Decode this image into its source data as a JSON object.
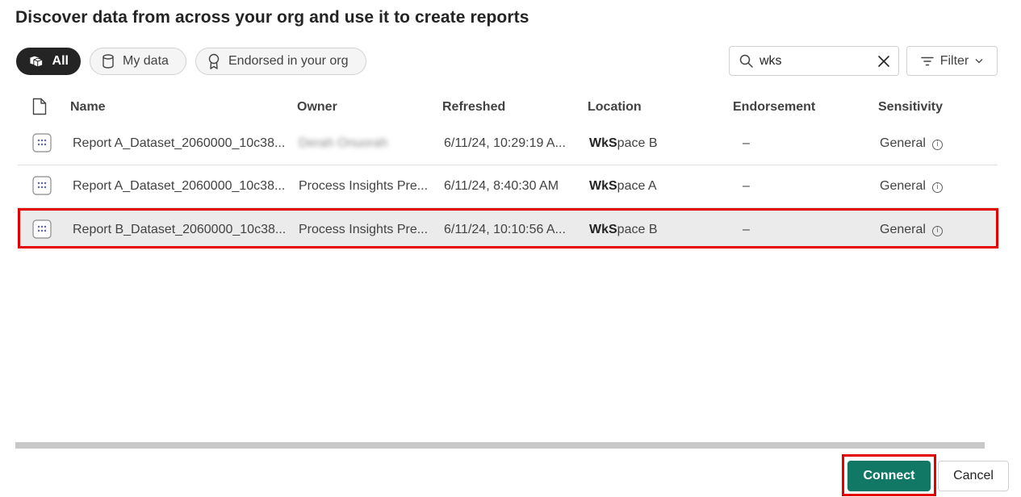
{
  "title": "Discover data from across your org and use it to create reports",
  "tabs": [
    {
      "label": "All",
      "icon": "cubes-icon",
      "active": true
    },
    {
      "label": "My data",
      "icon": "database-icon",
      "active": false
    },
    {
      "label": "Endorsed in your org",
      "icon": "ribbon-icon",
      "active": false
    }
  ],
  "search": {
    "value": "wks",
    "placeholder": ""
  },
  "filter": {
    "label": "Filter"
  },
  "table": {
    "columns": {
      "name": "Name",
      "owner": "Owner",
      "refreshed": "Refreshed",
      "location": "Location",
      "endorsement": "Endorsement",
      "sensitivity": "Sensitivity"
    },
    "rows": [
      {
        "name": "Report A_Dataset_2060000_10c38...",
        "owner": "Derah Onuorah",
        "refreshed": "6/11/24, 10:29:19 A...",
        "location_bold": "WkS",
        "location_rest": "pace B",
        "endorsement": "–",
        "sensitivity": "General",
        "selected": false
      },
      {
        "name": "Report A_Dataset_2060000_10c38...",
        "owner": "Process Insights Pre...",
        "refreshed": "6/11/24, 8:40:30 AM",
        "location_bold": "WkS",
        "location_rest": "pace A",
        "endorsement": "–",
        "sensitivity": "General",
        "selected": false
      },
      {
        "name": "Report B_Dataset_2060000_10c38...",
        "owner": "Process Insights Pre...",
        "refreshed": "6/11/24, 10:10:56 A...",
        "location_bold": "WkS",
        "location_rest": "pace B",
        "endorsement": "–",
        "sensitivity": "General",
        "selected": true
      }
    ]
  },
  "footer": {
    "connect_label": "Connect",
    "cancel_label": "Cancel"
  },
  "colors": {
    "primary": "#117865",
    "highlight": "#e40000",
    "active_tab": "#242424"
  }
}
